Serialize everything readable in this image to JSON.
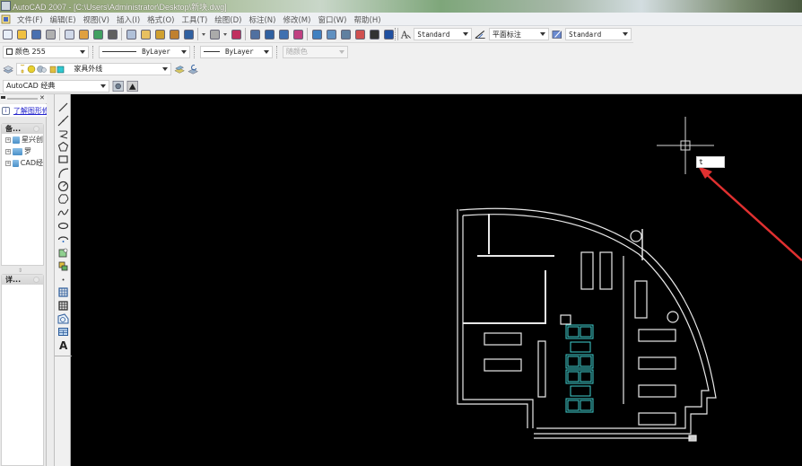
{
  "window": {
    "title": "AutoCAD 2007 - [C:\\Users\\Administrator\\Desktop\\新块.dwg]"
  },
  "menubar": {
    "items": [
      "文件(F)",
      "编辑(E)",
      "视图(V)",
      "插入(I)",
      "格式(O)",
      "工具(T)",
      "绘图(D)",
      "标注(N)",
      "修改(M)",
      "窗口(W)",
      "帮助(H)"
    ]
  },
  "standard_toolbar": {
    "icons": [
      "new-icon",
      "open-icon",
      "save-icon",
      "plot-icon",
      "plot-preview-icon",
      "publish-icon",
      "3d-dwf-icon",
      "cut-icon",
      "copy-icon",
      "paste-icon",
      "match-properties-icon",
      "block-editor-icon",
      "undo-icon",
      "undo-dropdown-icon",
      "redo-icon",
      "redo-dropdown-icon",
      "pan-icon",
      "zoom-realtime-icon",
      "zoom-window-icon",
      "zoom-previous-icon",
      "properties-icon",
      "design-center-icon",
      "tool-palettes-icon",
      "sheet-set-icon",
      "markup-icon",
      "quick-calc-icon",
      "help-icon"
    ]
  },
  "styles_toolbar": {
    "text_style": "Standard",
    "dim_style": "平面标注",
    "table_style": "Standard"
  },
  "properties_toolbar": {
    "color": "颜色 255",
    "linetype": "ByLayer",
    "lineweight": "ByLayer",
    "plot_style": "随颜色"
  },
  "layers_toolbar": {
    "current_layer": "家具外线"
  },
  "workspaces_toolbar": {
    "workspace": "AutoCAD 经典"
  },
  "side_panel": {
    "info_link": "了解图形修",
    "section1_title": "备...",
    "tree_items": [
      "星兴创",
      "罗",
      "CAD经"
    ],
    "section2_title": "详..."
  },
  "draw_toolbar": {
    "icons": [
      "line-icon",
      "construction-line-icon",
      "polyline-icon",
      "polygon-icon",
      "rectangle-icon",
      "arc-icon",
      "circle-icon",
      "revision-cloud-icon",
      "spline-icon",
      "ellipse-icon",
      "ellipse-arc-icon",
      "insert-block-icon",
      "make-block-icon",
      "point-icon",
      "hatch-icon",
      "gradient-icon",
      "region-icon",
      "table-icon",
      "multiline-text-icon"
    ],
    "text_glyph": "A"
  },
  "canvas": {
    "command_input": "t",
    "colors": {
      "background": "#000000",
      "wall": "#ffffff",
      "furniture_cyan": "#3fd0d0",
      "arrow": "#e03030"
    }
  }
}
